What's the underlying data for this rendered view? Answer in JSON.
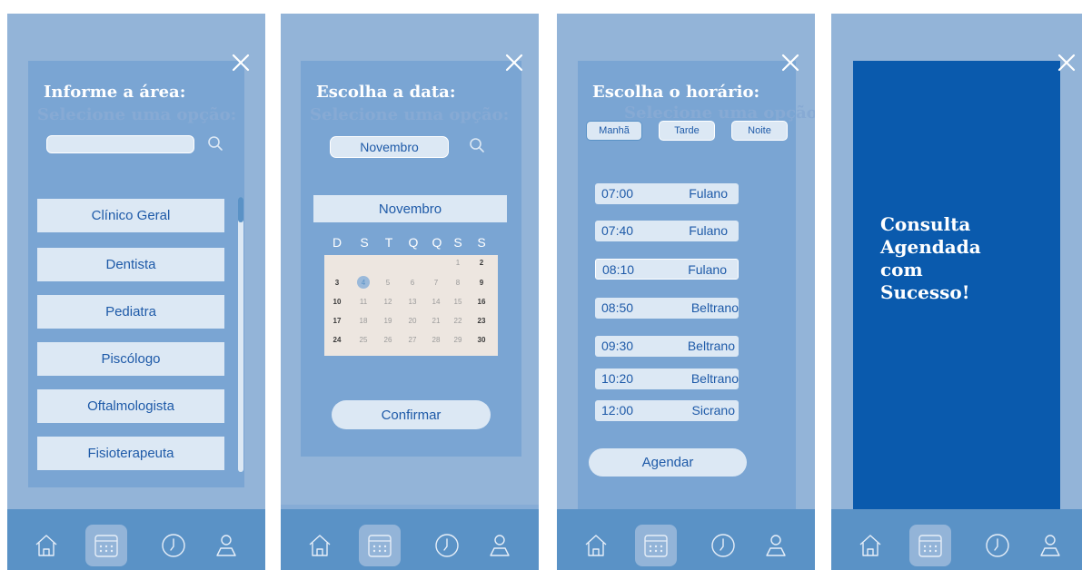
{
  "screens": {
    "area": {
      "title": "Informe a área:",
      "ghost_title": "Selecione uma opção:",
      "search_value": "",
      "options": [
        "Clínico Geral",
        "Dentista",
        "Pediatra",
        "Piscólogo",
        "Oftalmologista",
        "Fisioterapeuta"
      ]
    },
    "date": {
      "title": "Escolha a data:",
      "ghost_title": "Selecione uma opção:",
      "month_select": "Novembro",
      "calendar_month": "Novembro",
      "weekdays": [
        "D",
        "S",
        "T",
        "Q",
        "Q",
        "S",
        "S"
      ],
      "days": [
        "1",
        "2",
        "3",
        "4",
        "5",
        "6",
        "7",
        "8",
        "9",
        "10",
        "11",
        "12",
        "13",
        "14",
        "15",
        "16",
        "17",
        "18",
        "19",
        "20",
        "21",
        "22",
        "23",
        "24",
        "25",
        "26",
        "27",
        "28",
        "29",
        "30"
      ],
      "selected_day": "4",
      "confirm_label": "Confirmar"
    },
    "time": {
      "title": "Escolha o horário:",
      "ghost_title": "Selecione uma opção:",
      "shifts": [
        "Manhã",
        "Tarde",
        "Noite"
      ],
      "selected_shift": "Manhã",
      "slots": [
        {
          "time": "07:00",
          "doctor": "Fulano"
        },
        {
          "time": "07:40",
          "doctor": "Fulano"
        },
        {
          "time": "08:10",
          "doctor": "Fulano"
        },
        {
          "time": "08:50",
          "doctor": "Beltrano"
        },
        {
          "time": "09:30",
          "doctor": "Beltrano"
        },
        {
          "time": "10:20",
          "doctor": "Beltrano"
        },
        {
          "time": "12:00",
          "doctor": "Sicrano"
        }
      ],
      "agendar_label": "Agendar"
    },
    "success": {
      "message": "Consulta\nAgendada\ncom\nSucesso!"
    }
  },
  "nav": {
    "items": [
      "home-icon",
      "calendar-icon",
      "clock-icon",
      "user-icon"
    ],
    "active": "calendar-icon"
  },
  "colors": {
    "screen_bg": "#93b4d8",
    "panel_bg": "#7aa5d3",
    "nav_bg": "#5a92c6",
    "button_bg": "#dce8f4",
    "button_text": "#1e5aa8",
    "success_bg": "#0a5aad"
  }
}
